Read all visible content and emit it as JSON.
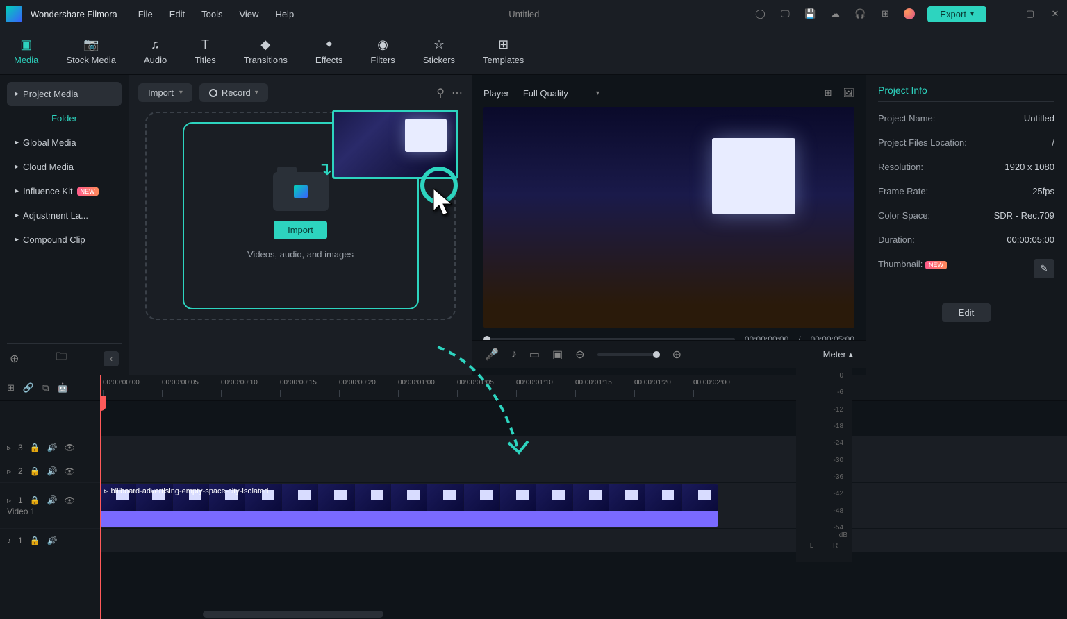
{
  "app": {
    "name": "Wondershare Filmora",
    "project": "Untitled"
  },
  "menubar": [
    "File",
    "Edit",
    "Tools",
    "View",
    "Help"
  ],
  "export_label": "Export",
  "tabs": [
    {
      "label": "Media",
      "active": true
    },
    {
      "label": "Stock Media"
    },
    {
      "label": "Audio"
    },
    {
      "label": "Titles"
    },
    {
      "label": "Transitions"
    },
    {
      "label": "Effects"
    },
    {
      "label": "Filters"
    },
    {
      "label": "Stickers"
    },
    {
      "label": "Templates"
    }
  ],
  "sidebar": {
    "project_media": "Project Media",
    "folder": "Folder",
    "items": [
      "Global Media",
      "Cloud Media",
      "Influence Kit",
      "Adjustment La...",
      "Compound Clip"
    ],
    "new_badge": "NEW"
  },
  "center": {
    "import_dd": "Import",
    "record_dd": "Record",
    "import_btn": "Import",
    "drop_hint": "Videos, audio, and images"
  },
  "preview": {
    "player_label": "Player",
    "quality": "Full Quality",
    "time_current": "00:00:00:00",
    "time_total": "00:00:05:00",
    "sep": "/"
  },
  "info": {
    "title": "Project Info",
    "rows": [
      {
        "k": "Project Name:",
        "v": "Untitled"
      },
      {
        "k": "Project Files Location:",
        "v": "/"
      },
      {
        "k": "Resolution:",
        "v": "1920 x 1080"
      },
      {
        "k": "Frame Rate:",
        "v": "25fps"
      },
      {
        "k": "Color Space:",
        "v": "SDR - Rec.709"
      },
      {
        "k": "Duration:",
        "v": "00:00:05:00"
      }
    ],
    "thumbnail": "Thumbnail:",
    "thumbnail_badge": "NEW",
    "edit_btn": "Edit"
  },
  "timeline": {
    "meter_label": "Meter",
    "ticks": [
      "00:00:00:00",
      "00:00:00:05",
      "00:00:00:10",
      "00:00:00:15",
      "00:00:00:20",
      "00:00:01:00",
      "00:00:01:05",
      "00:00:01:10",
      "00:00:01:15",
      "00:00:01:20",
      "00:00:02:00"
    ],
    "tracks": [
      {
        "name": "3"
      },
      {
        "name": "2"
      },
      {
        "name": "1",
        "main": true,
        "label": "Video 1"
      }
    ],
    "audio_track": "1",
    "clip_name": "billboard-advertising-empty-space-city-isolated",
    "meter_db": [
      "0",
      "-6",
      "-12",
      "-18",
      "-24",
      "-30",
      "-36",
      "-42",
      "-48",
      "-54"
    ],
    "meter_unit": "dB",
    "meter_L": "L",
    "meter_R": "R"
  }
}
